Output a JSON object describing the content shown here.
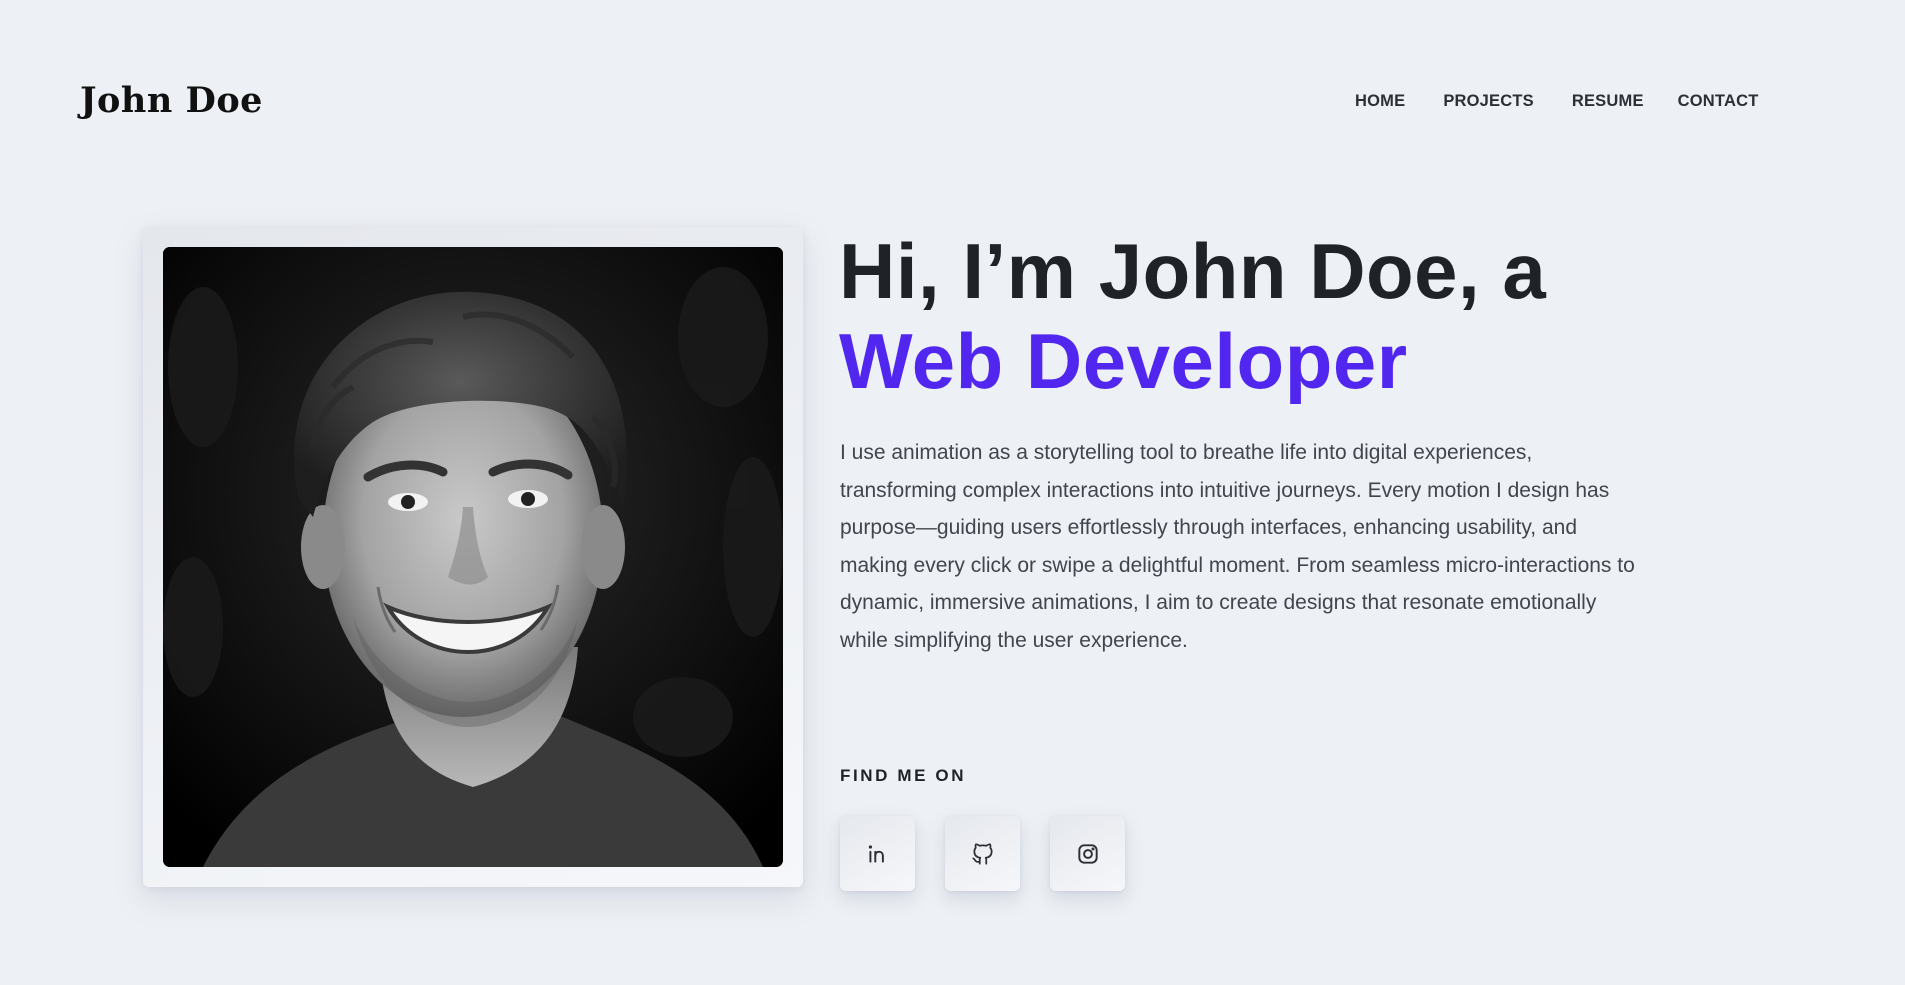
{
  "header": {
    "logo": "John Doe",
    "nav": [
      {
        "label": "HOME"
      },
      {
        "label": "PROJECTS"
      },
      {
        "label": "RESUME"
      },
      {
        "label": "CONTACT"
      }
    ]
  },
  "hero": {
    "headline_line1": "Hi, I’m John Doe, a",
    "headline_accent": "Web Developer",
    "bio": "I use animation as a storytelling tool to breathe life into digital experiences, transforming complex interactions into intuitive journeys. Every motion I design has purpose—guiding users effortlessly through interfaces, enhancing usability, and making every click or swipe a delightful moment. From seamless micro-interactions to dynamic, immersive animations, I aim to create designs that resonate emotionally while simplifying the user experience.",
    "photo_icon": "portrait-photo",
    "find_me_label": "FIND ME ON",
    "socials": [
      {
        "name": "linkedin-icon"
      },
      {
        "name": "github-icon"
      },
      {
        "name": "instagram-icon"
      }
    ]
  },
  "colors": {
    "background": "#edf0f4",
    "accent": "#5127ef",
    "text": "#1f2327"
  }
}
